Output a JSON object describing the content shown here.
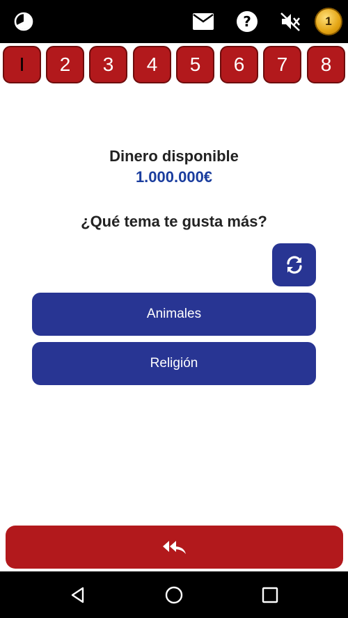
{
  "header": {
    "icons": [
      "timer-icon",
      "mail-icon",
      "help-icon",
      "mute-icon",
      "coin-icon"
    ],
    "coin_count": "1"
  },
  "steps": [
    {
      "label": "I",
      "active": true
    },
    {
      "label": "2",
      "active": false
    },
    {
      "label": "3",
      "active": false
    },
    {
      "label": "4",
      "active": false
    },
    {
      "label": "5",
      "active": false
    },
    {
      "label": "6",
      "active": false
    },
    {
      "label": "7",
      "active": false
    },
    {
      "label": "8",
      "active": false
    }
  ],
  "main": {
    "money_title": "Dinero disponible",
    "money_value": "1.000.000€",
    "question": "¿Qué tema te gusta más?",
    "options": [
      {
        "label": "Animales"
      },
      {
        "label": "Religión"
      }
    ]
  },
  "colors": {
    "red": "#b2191c",
    "blue": "#283593",
    "money_blue": "#1a3d9e"
  },
  "footer": {
    "back_icon": "reply-all-icon"
  },
  "navbar": {
    "icons": [
      "back-triangle-icon",
      "home-circle-icon",
      "recents-square-icon"
    ]
  }
}
